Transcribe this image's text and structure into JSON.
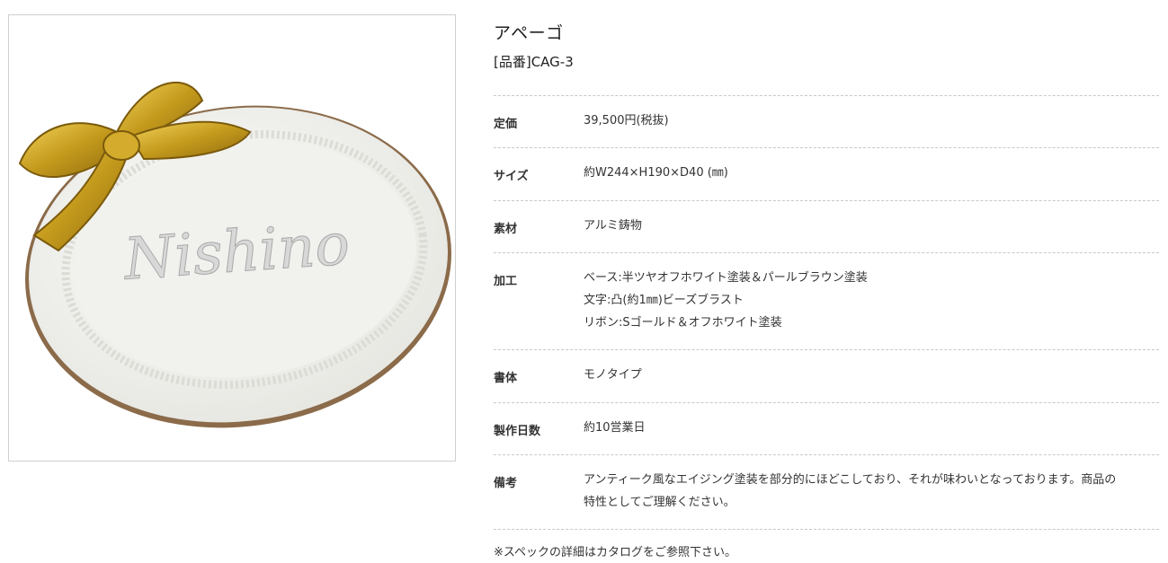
{
  "product": {
    "name": "アペーゴ",
    "code": "[品番]CAG-3",
    "image_plate_text": "Nishino"
  },
  "specs": [
    {
      "label": "定価",
      "lines": [
        "39,500円(税抜)"
      ]
    },
    {
      "label": "サイズ",
      "lines": [
        "約W244×H190×D40 (㎜)"
      ]
    },
    {
      "label": "素材",
      "lines": [
        "アルミ鋳物"
      ]
    },
    {
      "label": "加工",
      "lines": [
        "ベース:半ツヤオフホワイト塗装＆パールブラウン塗装",
        "文字:凸(約1㎜)ビーズブラスト",
        "リボン:Sゴールド＆オフホワイト塗装"
      ]
    },
    {
      "label": "書体",
      "lines": [
        "モノタイプ"
      ]
    },
    {
      "label": "製作日数",
      "lines": [
        "約10営業日"
      ]
    },
    {
      "label": "備考",
      "lines": [
        "アンティーク風なエイジング塗装を部分的にほどこしており、それが味わいとなっております。商品の",
        "特性としてご理解ください。"
      ]
    }
  ],
  "note": "※スペックの詳細はカタログをご参照下さい。",
  "colors": {
    "plate": "#f4f4f1",
    "gold": "#c9a227",
    "rim": "#8b6b4a",
    "divider": "#c8c8c8"
  }
}
